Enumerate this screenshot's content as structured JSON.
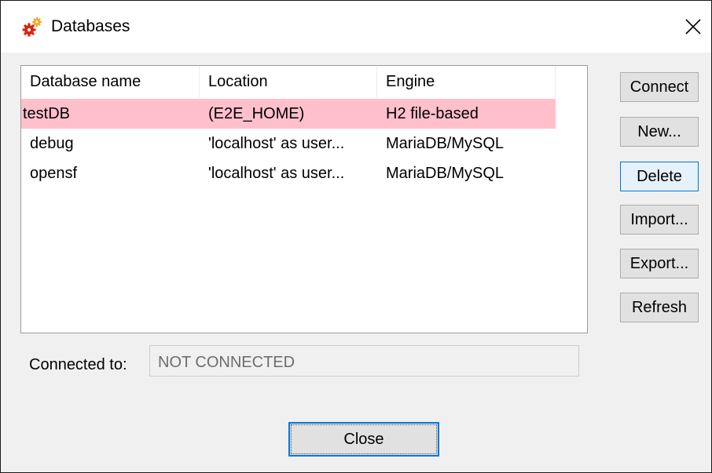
{
  "window": {
    "title": "Databases",
    "icon": "gears-icon",
    "close_glyph": "✕"
  },
  "list": {
    "columns": [
      "Database name",
      "Location",
      "Engine"
    ],
    "rows": [
      {
        "name": "testDB",
        "location": "(E2E_HOME)",
        "engine": "H2 file-based",
        "selected": true
      },
      {
        "name": "debug",
        "location": "'localhost' as user...",
        "engine": "MariaDB/MySQL",
        "selected": false
      },
      {
        "name": "opensf",
        "location": "'localhost' as user...",
        "engine": "MariaDB/MySQL",
        "selected": false
      }
    ],
    "selected_color": "#ffc0cb"
  },
  "buttons": {
    "connect": "Connect",
    "new": "New...",
    "delete": "Delete",
    "import": "Import...",
    "export": "Export...",
    "refresh": "Refresh"
  },
  "connection": {
    "label": "Connected to:",
    "value": "NOT CONNECTED"
  },
  "footer": {
    "close_label": "Close"
  },
  "colors": {
    "accent": "#0078d7",
    "dialog_bg": "#f0f0f0"
  }
}
